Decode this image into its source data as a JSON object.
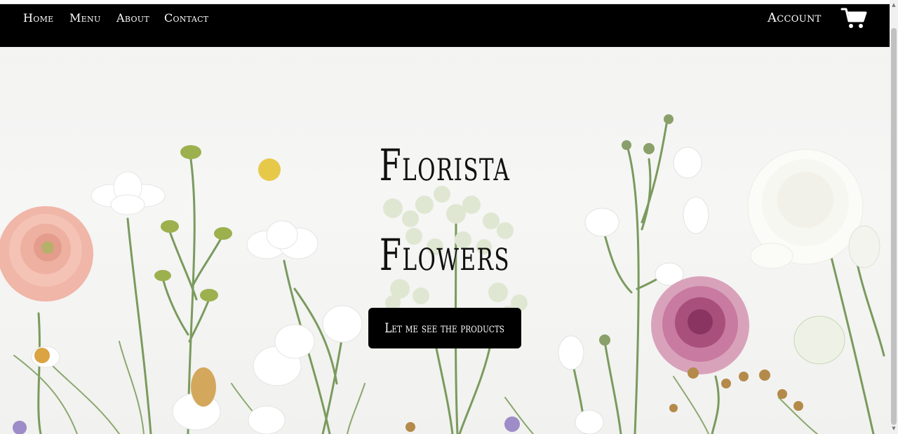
{
  "nav": {
    "home": "Home",
    "menu": "Menu",
    "about": "About",
    "contact": "Contact",
    "account": "Account",
    "cart_icon": "shopping-cart-icon"
  },
  "hero": {
    "title_line1": "Florista",
    "title_line2": "Flowers",
    "cta_label": "Let me see the products"
  },
  "colors": {
    "navbar": "#000000",
    "nav_text": "#ffffff",
    "hero_bg": "#f3f3f2",
    "button_bg": "#000000",
    "button_text": "#ffffff"
  }
}
